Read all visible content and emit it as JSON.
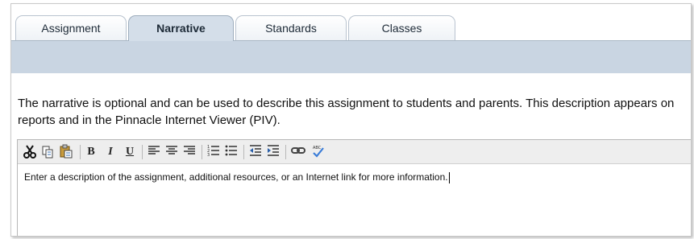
{
  "tabs": [
    {
      "label": "Assignment",
      "active": false
    },
    {
      "label": "Narrative",
      "active": true
    },
    {
      "label": "Standards",
      "active": false
    },
    {
      "label": "Classes",
      "active": false
    }
  ],
  "description": "The narrative is optional and can be used to describe this assignment to students and parents.  This description appears on reports and in the Pinnacle Internet Viewer (PIV).",
  "editor": {
    "toolbar_buttons": [
      {
        "icon": "cut-icon"
      },
      {
        "icon": "copy-icon"
      },
      {
        "icon": "paste-icon"
      },
      {
        "icon": "bold-icon",
        "label": "B"
      },
      {
        "icon": "italic-icon",
        "label": "I"
      },
      {
        "icon": "underline-icon",
        "label": "U"
      },
      {
        "icon": "align-left-icon"
      },
      {
        "icon": "align-center-icon"
      },
      {
        "icon": "align-right-icon"
      },
      {
        "icon": "numbered-list-icon"
      },
      {
        "icon": "bulleted-list-icon"
      },
      {
        "icon": "outdent-icon"
      },
      {
        "icon": "indent-icon"
      },
      {
        "icon": "link-icon"
      },
      {
        "icon": "spellcheck-icon",
        "label": "ABC"
      }
    ],
    "content": "Enter a description of the assignment, additional resources, or an Internet link for more information."
  },
  "colors": {
    "tab_active": "#d4dee9",
    "band": "#c9d5e2",
    "toolbar": "#eeeeee"
  }
}
